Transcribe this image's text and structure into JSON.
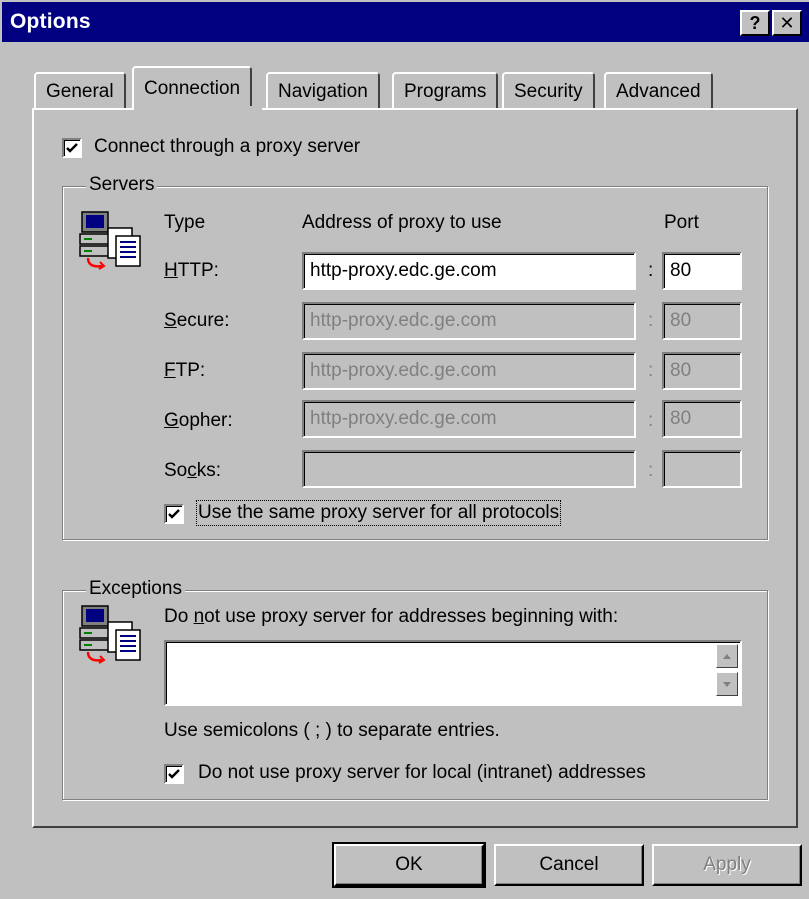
{
  "window": {
    "title": "Options",
    "help_button": "?",
    "close_button": "✕"
  },
  "tabs": [
    {
      "label": "General"
    },
    {
      "label": "Connection",
      "active": true
    },
    {
      "label": "Navigation"
    },
    {
      "label": "Programs"
    },
    {
      "label": "Security"
    },
    {
      "label": "Advanced"
    }
  ],
  "connection": {
    "use_proxy": {
      "label": "Connect through a proxy server",
      "checked": true
    },
    "servers": {
      "group_title": "Servers",
      "icon": "network-computers-icon",
      "col_type": "Type",
      "col_address": "Address of proxy to use",
      "col_port": "Port",
      "rows": [
        {
          "type": "HTTP:",
          "address": "http-proxy.edc.ge.com",
          "port": "80",
          "enabled": true
        },
        {
          "type": "Secure:",
          "address": "http-proxy.edc.ge.com",
          "port": "80",
          "enabled": false
        },
        {
          "type": "FTP:",
          "address": "http-proxy.edc.ge.com",
          "port": "80",
          "enabled": false
        },
        {
          "type": "Gopher:",
          "address": "http-proxy.edc.ge.com",
          "port": "80",
          "enabled": false
        },
        {
          "type": "Socks:",
          "address": "",
          "port": "",
          "enabled": false
        }
      ],
      "colon": ":",
      "same_proxy": {
        "label": "Use the same proxy server for all protocols",
        "checked": true
      }
    },
    "exceptions": {
      "group_title": "Exceptions",
      "icon": "network-computers-icon",
      "description": "Do not use proxy server for addresses beginning with:",
      "value": "",
      "hint": "Use semicolons ( ; ) to separate entries.",
      "local": {
        "label": "Do not use proxy server for local (intranet) addresses",
        "checked": true
      }
    }
  },
  "buttons": {
    "ok": "OK",
    "cancel": "Cancel",
    "apply": "Apply"
  },
  "colors": {
    "title_bar": "#000080",
    "face": "#c0c0c0"
  }
}
